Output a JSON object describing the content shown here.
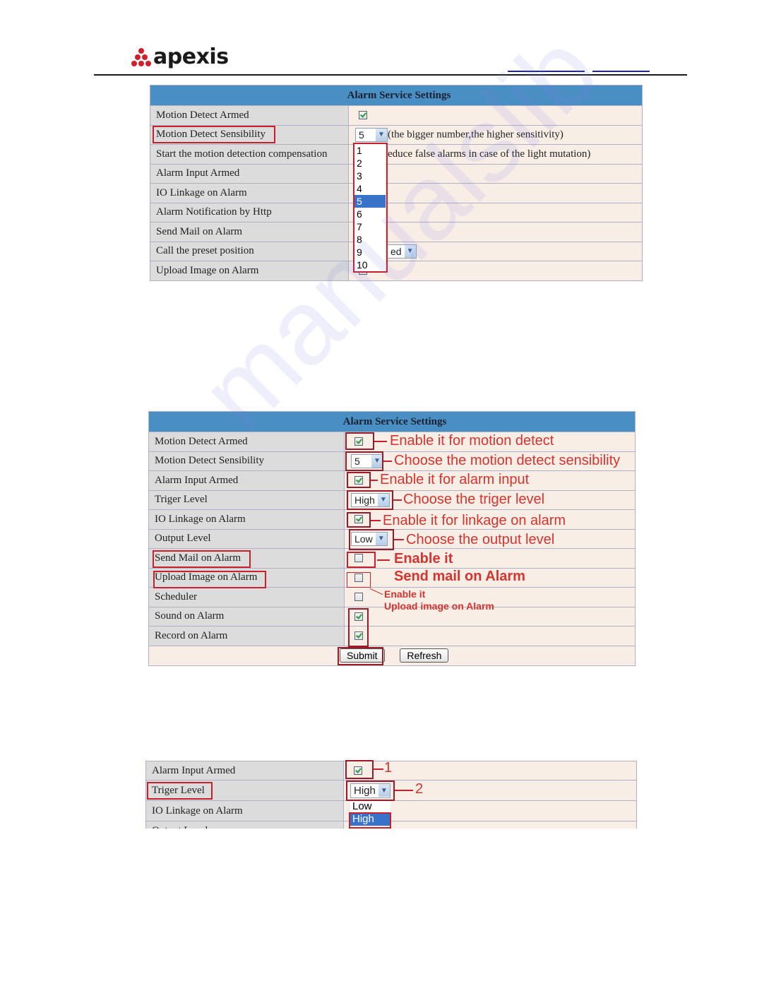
{
  "brand": {
    "name": "apexis",
    "logo_icon": "apexis-dots-logo-icon"
  },
  "watermark": "manualslib",
  "table1": {
    "title": "Alarm Service Settings",
    "rows": [
      {
        "label": "Motion Detect Armed",
        "type": "checkbox",
        "checked": true
      },
      {
        "label": "Motion Detect Sensibility",
        "type": "select",
        "value": "5",
        "note": "(the bigger number,the higher sensitivity)"
      },
      {
        "label": "Start the motion detection compensation",
        "type": "text",
        "note": "educe false alarms in case of the light mutation)"
      },
      {
        "label": "Alarm Input Armed",
        "type": "empty"
      },
      {
        "label": "IO Linkage on Alarm",
        "type": "empty"
      },
      {
        "label": "Alarm Notification by Http",
        "type": "empty"
      },
      {
        "label": "Send Mail on Alarm",
        "type": "empty"
      },
      {
        "label": "Call the preset position",
        "type": "select-partial",
        "value": "ed"
      },
      {
        "label": "Upload Image on Alarm",
        "type": "checkbox",
        "checked": false
      }
    ],
    "dropdown_options": [
      "1",
      "2",
      "3",
      "4",
      "5",
      "6",
      "7",
      "8",
      "9",
      "10"
    ],
    "dropdown_selected": "5"
  },
  "table2": {
    "title": "Alarm Service Settings",
    "rows": [
      {
        "label": "Motion Detect Armed",
        "type": "checkbox",
        "checked": true
      },
      {
        "label": "Motion Detect Sensibility",
        "type": "select",
        "value": "5"
      },
      {
        "label": "Alarm Input Armed",
        "type": "checkbox",
        "checked": true
      },
      {
        "label": "Triger Level",
        "type": "select",
        "value": "High"
      },
      {
        "label": "IO Linkage on Alarm",
        "type": "checkbox",
        "checked": true
      },
      {
        "label": "Output Level",
        "type": "select",
        "value": "Low"
      },
      {
        "label": "Send Mail on Alarm",
        "type": "checkbox",
        "checked": false
      },
      {
        "label": "Upload Image on Alarm",
        "type": "checkbox",
        "checked": false
      },
      {
        "label": "Scheduler",
        "type": "checkbox",
        "checked": false
      },
      {
        "label": "Sound on Alarm",
        "type": "checkbox",
        "checked": true
      },
      {
        "label": "Record on Alarm",
        "type": "checkbox",
        "checked": true
      }
    ],
    "submit_label": "Submit",
    "refresh_label": "Refresh",
    "annotations": {
      "motion_detect": "Enable it for motion detect",
      "sensibility": "Choose the motion detect sensibility",
      "alarm_input": "Enable it for alarm input",
      "triger_level": "Choose the triger level",
      "linkage": "Enable it for linkage on alarm",
      "output_level": "Choose the output level",
      "send_mail_1": "Enable it",
      "send_mail_2": "Send mail on Alarm",
      "upload_1": "Enable it",
      "upload_2": "Upload image on Alarm"
    }
  },
  "table3": {
    "rows": [
      {
        "label": "Alarm Input Armed",
        "type": "checkbox",
        "checked": true
      },
      {
        "label": "Triger Level",
        "type": "select",
        "value": "High"
      },
      {
        "label": "IO Linkage on Alarm",
        "type": "empty"
      },
      {
        "label": "Output Level",
        "type": "empty"
      }
    ],
    "dropdown_options": [
      "Low",
      "High"
    ],
    "dropdown_selected": "High",
    "annotations": {
      "step1": "1",
      "step2": "2"
    }
  }
}
